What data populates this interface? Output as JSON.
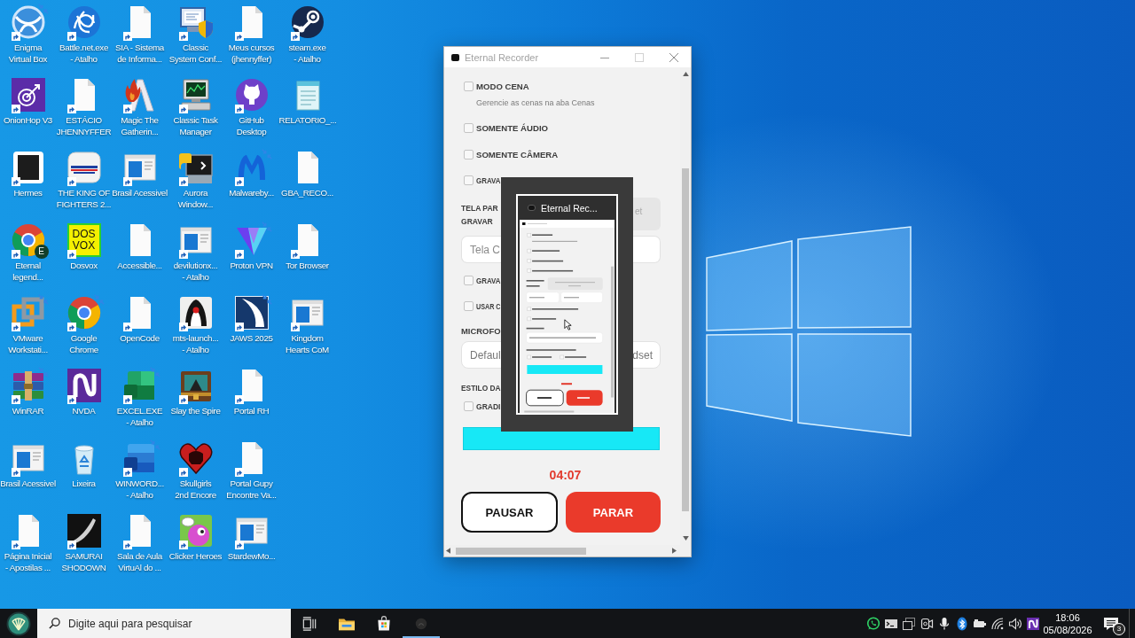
{
  "desktop": {
    "rows": [
      [
        {
          "label": "Enigma Virtual Box",
          "shortcut": true,
          "compressed": true
        },
        {
          "label": "Battle.net.exe - Atalho",
          "shortcut": true,
          "compressed": false
        },
        {
          "label": "SIA - Sistema de Informa...",
          "shortcut": true,
          "compressed": false
        },
        {
          "label": "Classic System Conf...",
          "shortcut": true,
          "compressed": false
        },
        {
          "label": "Meus cursos (jhennyffer)",
          "shortcut": true,
          "compressed": false
        },
        {
          "label": "steam.exe - Atalho",
          "shortcut": true,
          "compressed": false
        }
      ],
      [
        {
          "label": "OnionHop V3",
          "shortcut": true,
          "compressed": false
        },
        {
          "label": "ESTÁCIO JHENNYFFER",
          "shortcut": true,
          "compressed": false
        },
        {
          "label": "Magic The Gatherin...",
          "shortcut": true,
          "compressed": false
        },
        {
          "label": "Classic Task Manager",
          "shortcut": true,
          "compressed": false
        },
        {
          "label": "GitHub Desktop",
          "shortcut": true,
          "compressed": false
        },
        {
          "label": "RELATORIO_...",
          "shortcut": false,
          "compressed": false
        }
      ],
      [
        {
          "label": "Hermes",
          "shortcut": true,
          "compressed": false
        },
        {
          "label": "THE KING OF FIGHTERS 2...",
          "shortcut": true,
          "compressed": false
        },
        {
          "label": "Brasil Acessivel",
          "shortcut": true,
          "compressed": false
        },
        {
          "label": "Aurora Window...",
          "shortcut": true,
          "compressed": false
        },
        {
          "label": "Malwareby...",
          "shortcut": true,
          "compressed": true
        },
        {
          "label": "GBA_RECO...",
          "shortcut": false,
          "compressed": false
        }
      ],
      [
        {
          "label": "Eternal legend...",
          "shortcut": true,
          "compressed": false,
          "badge": "E"
        },
        {
          "label": "Dosvox",
          "shortcut": true,
          "compressed": false,
          "logo_text": "DOS VOX"
        },
        {
          "label": "Accessible...",
          "shortcut": false,
          "compressed": false
        },
        {
          "label": "devilutionx... - Atalho",
          "shortcut": true,
          "compressed": false
        },
        {
          "label": "Proton VPN",
          "shortcut": true,
          "compressed": true
        },
        {
          "label": "Tor Browser",
          "shortcut": true,
          "compressed": false
        }
      ],
      [
        {
          "label": "VMware Workstati...",
          "shortcut": true,
          "compressed": true
        },
        {
          "label": "Google Chrome",
          "shortcut": true,
          "compressed": true
        },
        {
          "label": "OpenCode",
          "shortcut": true,
          "compressed": false
        },
        {
          "label": "mts-launch... - Atalho",
          "shortcut": true,
          "compressed": false
        },
        {
          "label": "JAWS 2025",
          "shortcut": true,
          "compressed": true
        },
        {
          "label": "Kingdom Hearts CoM",
          "shortcut": true,
          "compressed": false
        }
      ],
      [
        {
          "label": "WinRAR",
          "shortcut": true,
          "compressed": true
        },
        {
          "label": "NVDA",
          "shortcut": true,
          "compressed": false
        },
        {
          "label": "EXCEL.EXE - Atalho",
          "shortcut": true,
          "compressed": true
        },
        {
          "label": "Slay the Spire",
          "shortcut": true,
          "compressed": false
        },
        {
          "label": "Portal RH",
          "shortcut": true,
          "compressed": false
        }
      ],
      [
        {
          "label": "Brasil Acessivel",
          "shortcut": true,
          "compressed": false
        },
        {
          "label": "Lixeira",
          "shortcut": false,
          "compressed": false
        },
        {
          "label": "WINWORD... - Atalho",
          "shortcut": true,
          "compressed": true
        },
        {
          "label": "Skullgirls 2nd Encore",
          "shortcut": true,
          "compressed": false
        },
        {
          "label": "Portal Gupy Encontre Va...",
          "shortcut": true,
          "compressed": false
        }
      ],
      [
        {
          "label": "Página Inicial - Apostilas ...",
          "shortcut": true,
          "compressed": false
        },
        {
          "label": "SAMURAI SHODOWN",
          "shortcut": true,
          "compressed": false
        },
        {
          "label": "Sala de Aula VirtuAl do ...",
          "shortcut": true,
          "compressed": false
        },
        {
          "label": "Clicker Heroes",
          "shortcut": true,
          "compressed": false
        },
        {
          "label": "StardewMo...",
          "shortcut": true,
          "compressed": false
        }
      ]
    ]
  },
  "recorder_window": {
    "title": "Eternal Recorder",
    "options": [
      {
        "label": "MODO CENA",
        "checked": false,
        "hint": "Gerencie as cenas na aba Cenas"
      },
      {
        "label": "SOMENTE ÁUDIO",
        "checked": false
      },
      {
        "label": "SOMENTE CÂMERA",
        "checked": false
      },
      {
        "label": "GRAVA",
        "checked": false
      }
    ],
    "screen_label": "TELA PAR GRAVAR",
    "load_button": "et",
    "screen_fields": [
      "Tela C"
    ],
    "toggles": [
      {
        "label": "GRAVA",
        "checked": false
      },
      {
        "label": "USAR C",
        "checked": false
      }
    ],
    "microphone_label": "MICROFO",
    "microphone": {
      "start": "Defaul",
      "end": "dset"
    },
    "border_label": "ESTILO DA",
    "border_options": [
      {
        "label": "GRADI",
        "checked": false
      }
    ],
    "timer": "04:07",
    "buttons": [
      {
        "label": "PAUSAR",
        "kind": "pause"
      },
      {
        "label": "PARAR",
        "kind": "stop"
      }
    ]
  },
  "preview": {
    "title": "Eternal Rec...",
    "selected": true
  },
  "taskbar": {
    "search": {
      "placeholder": "Digite aqui para pesquisar"
    },
    "apps": [
      {
        "active": false
      },
      {
        "active": false
      },
      {
        "active": true
      }
    ],
    "clock": {
      "time": "18:06",
      "date": "05/08/2026"
    },
    "notifications": {
      "count": "3"
    }
  }
}
